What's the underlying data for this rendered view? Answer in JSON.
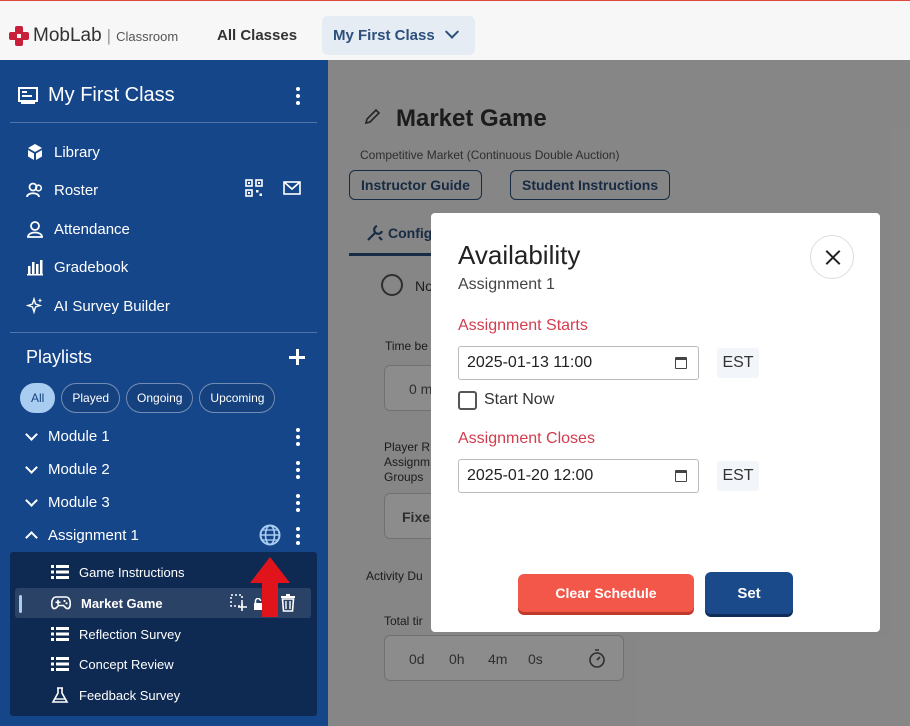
{
  "topbar": {
    "logo_text": "MobLab",
    "logo_sub": "Classroom",
    "all_classes": "All Classes",
    "current_class": "My First Class"
  },
  "sidebar": {
    "class_title": "My First Class",
    "nav": [
      {
        "label": "Library",
        "icon": "library-icon"
      },
      {
        "label": "Roster",
        "icon": "roster-icon"
      },
      {
        "label": "Attendance",
        "icon": "attendance-icon"
      },
      {
        "label": "Gradebook",
        "icon": "gradebook-icon"
      },
      {
        "label": "AI Survey Builder",
        "icon": "ai-sparkle-icon"
      }
    ],
    "playlists_label": "Playlists",
    "filters": [
      "All",
      "Played",
      "Ongoing",
      "Upcoming"
    ],
    "active_filter": "All",
    "modules": [
      "Module 1",
      "Module 2",
      "Module 3",
      "Assignment 1"
    ],
    "assignment_items": [
      "Game Instructions",
      "Market Game",
      "Reflection Survey",
      "Concept Review",
      "Feedback Survey"
    ],
    "selected_item": "Market Game"
  },
  "main": {
    "title": "Market Game",
    "subtitle": "Competitive Market (Continuous Double Auction)",
    "instructor_guide": "Instructor Guide",
    "student_instructions": "Student Instructions",
    "tab_config": "Config",
    "radio_partial": "No",
    "time_label_partial": "Time be",
    "time_value_partial": "0 m",
    "player_label_lines": [
      "Player R",
      "Assignm",
      "Groups"
    ],
    "fixed_partial": "Fixe",
    "activity_partial": "Activity Du",
    "total_time_partial": "Total tir",
    "total_time_value": {
      "d": "0d",
      "h": "0h",
      "m": "4m",
      "s": "0s"
    }
  },
  "modal": {
    "title": "Availability",
    "subtitle": "Assignment 1",
    "starts_label": "Assignment Starts",
    "starts_value": "2025-01-13 11:00",
    "starts_tz": "EST",
    "start_now_label": "Start Now",
    "start_now_checked": false,
    "closes_label": "Assignment Closes",
    "closes_value": "2025-01-20 12:00",
    "closes_tz": "EST",
    "clear_button": "Clear Schedule",
    "set_button": "Set"
  },
  "colors": {
    "sidebar_bg": "#16468a",
    "sub_panel_bg": "#0f2a52",
    "accent_red": "#d23c4e",
    "clear_btn": "#f3574a",
    "set_btn": "#1b4a8a",
    "arrow": "#e0141a"
  }
}
